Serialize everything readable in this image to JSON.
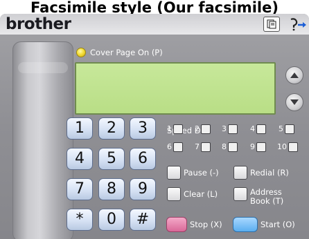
{
  "title": "Facsimile style (Our facsimile)",
  "brand": "brother",
  "cover_page": {
    "label": "Cover Page On (P)",
    "led_color": "#f4df38"
  },
  "lcd": {
    "text": "",
    "color": "#bfe28f"
  },
  "keypad": [
    "1",
    "2",
    "3",
    "4",
    "5",
    "6",
    "7",
    "8",
    "9",
    "*",
    "0",
    "#"
  ],
  "speed_dial": {
    "label": "Speed Dial",
    "slots": [
      "1",
      "2",
      "3",
      "4",
      "5",
      "6",
      "7",
      "8",
      "9",
      "10"
    ]
  },
  "functions": {
    "pause": "Pause (-)",
    "redial": "Redial (R)",
    "clear": "Clear (L)",
    "address_book": "Address Book (T)"
  },
  "actions": {
    "stop": "Stop (X)",
    "start": "Start (O)"
  },
  "colors": {
    "body": "#909095",
    "key": "#d6e2f4",
    "stop": "#e07aa6",
    "start": "#6ab4f4"
  },
  "icons": [
    "copy-icon",
    "help-icon",
    "scroll-up-icon",
    "scroll-down-icon",
    "cover-page-led-icon",
    "phone-handset-icon"
  ]
}
